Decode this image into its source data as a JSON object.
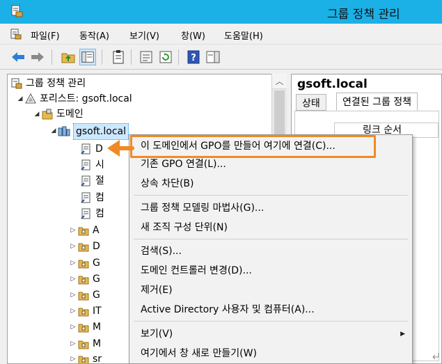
{
  "window": {
    "title": "그룹 정책 관리",
    "colors": {
      "titlebar": "#1bb0e6",
      "accent_orange": "#f08a24",
      "selection": "#cce8ff"
    }
  },
  "menubar": {
    "items": [
      {
        "label": "파일(F)"
      },
      {
        "label": "동작(A)"
      },
      {
        "label": "보기(V)"
      },
      {
        "label": "창(W)"
      },
      {
        "label": "도움말(H)"
      }
    ]
  },
  "toolbar": {
    "icons": [
      "back-arrow-icon",
      "forward-arrow-icon",
      "folder-up-icon",
      "console-tree-icon",
      "clipboard-icon",
      "properties-icon",
      "refresh-icon",
      "help-icon",
      "action-pane-icon"
    ]
  },
  "tree": {
    "root": "그룹 정책 관리",
    "forest": "포리스트: gsoft.local",
    "domains": "도메인",
    "domain": "gsoft.local",
    "children": [
      {
        "label": "D",
        "kind": "gpo-link"
      },
      {
        "label": "시",
        "kind": "gpo-link"
      },
      {
        "label": "절",
        "kind": "gpo-link"
      },
      {
        "label": "컴",
        "kind": "gpo-link"
      },
      {
        "label": "컴",
        "kind": "gpo-link"
      },
      {
        "label": "A",
        "kind": "ou"
      },
      {
        "label": "D",
        "kind": "ou"
      },
      {
        "label": "G",
        "kind": "ou"
      },
      {
        "label": "G",
        "kind": "ou"
      },
      {
        "label": "G",
        "kind": "ou"
      },
      {
        "label": "IT",
        "kind": "ou"
      },
      {
        "label": "M",
        "kind": "ou"
      },
      {
        "label": "M",
        "kind": "ou"
      },
      {
        "label": "sr",
        "kind": "ou"
      }
    ]
  },
  "right_pane": {
    "title": "gsoft.local",
    "tabs": [
      "상태",
      "연결된 그룹 정책"
    ],
    "column_header": "링크 순서"
  },
  "context_menu": {
    "items": [
      {
        "label": "이 도메인에서 GPO를 만들어 여기에 연결(C)...",
        "highlighted": true
      },
      {
        "label": "기존 GPO 연결(L)..."
      },
      {
        "label": "상속 차단(B)"
      },
      {
        "separator": true
      },
      {
        "label": "그룹 정책 모델링 마법사(G)..."
      },
      {
        "label": "새 조직 구성 단위(N)"
      },
      {
        "separator": true
      },
      {
        "label": "검색(S)..."
      },
      {
        "label": "도메인 컨트롤러 변경(D)..."
      },
      {
        "label": "제거(E)"
      },
      {
        "label": "Active Directory 사용자 및 컴퓨터(A)..."
      },
      {
        "separator": true
      },
      {
        "label": "보기(V)",
        "submenu": true
      },
      {
        "label": "여기에서 창 새로 만들기(W)"
      }
    ]
  }
}
